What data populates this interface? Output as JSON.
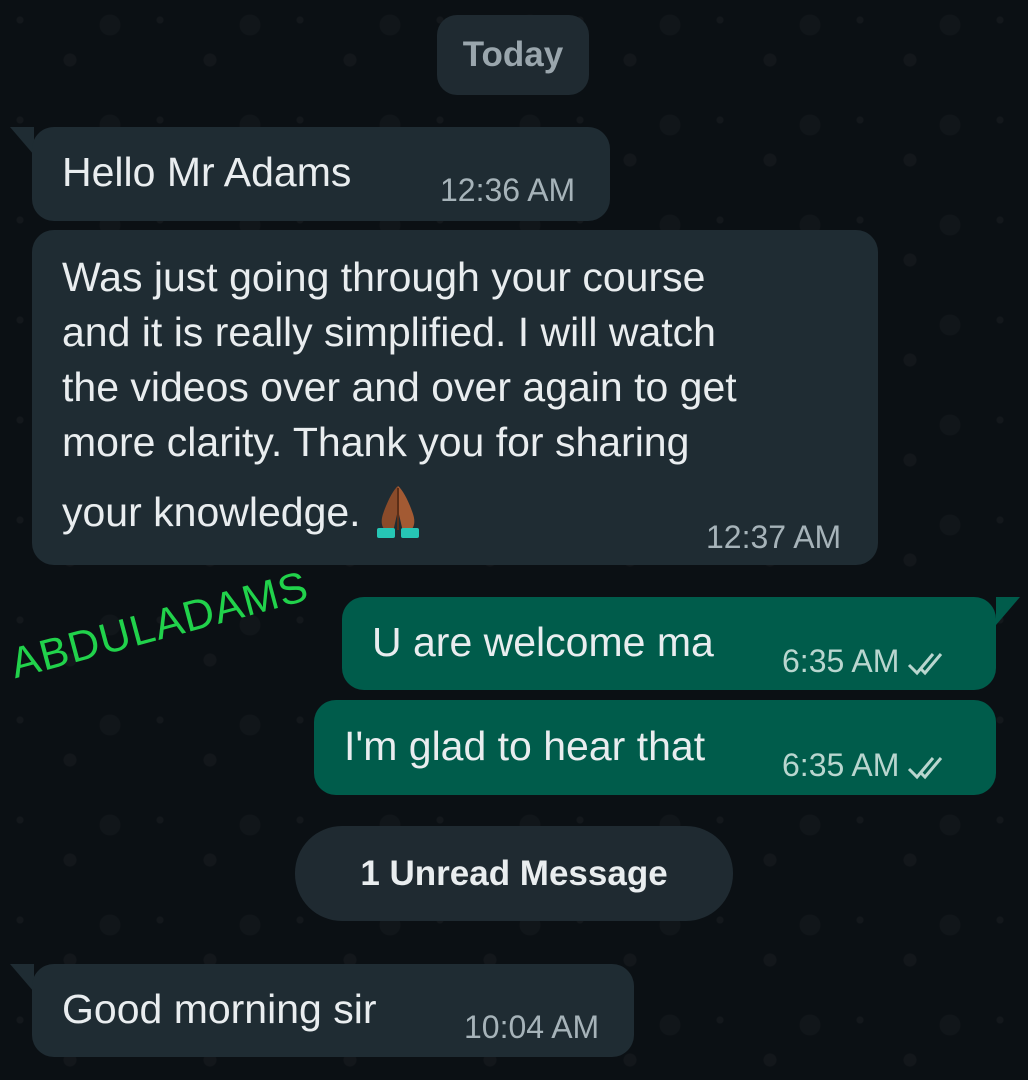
{
  "date_separator": "Today",
  "messages": [
    {
      "direction": "incoming",
      "text": "Hello Mr Adams",
      "time": "12:36 AM"
    },
    {
      "direction": "incoming",
      "lines": [
        "Was just going through your course",
        "and it is really simplified. I will watch",
        "the videos over and over again to get",
        "more clarity.  Thank you for sharing",
        "your knowledge."
      ],
      "emoji": "folded-hands-emoji",
      "time": "12:37 AM"
    },
    {
      "direction": "outgoing",
      "text": "U are welcome ma",
      "time": "6:35 AM",
      "status": "read-double-tick-icon"
    },
    {
      "direction": "outgoing",
      "text": "I'm glad to hear that",
      "time": "6:35 AM",
      "status": "read-double-tick-icon"
    },
    {
      "direction": "incoming",
      "text": "Good morning sir",
      "time": "10:04 AM"
    }
  ],
  "unread_banner": "1 Unread Message",
  "watermark": "ABDULADAMS",
  "colors": {
    "background": "#0b1014",
    "incoming_bubble": "#1f2c33",
    "outgoing_bubble": "#005c4b",
    "watermark": "#21d24b"
  }
}
